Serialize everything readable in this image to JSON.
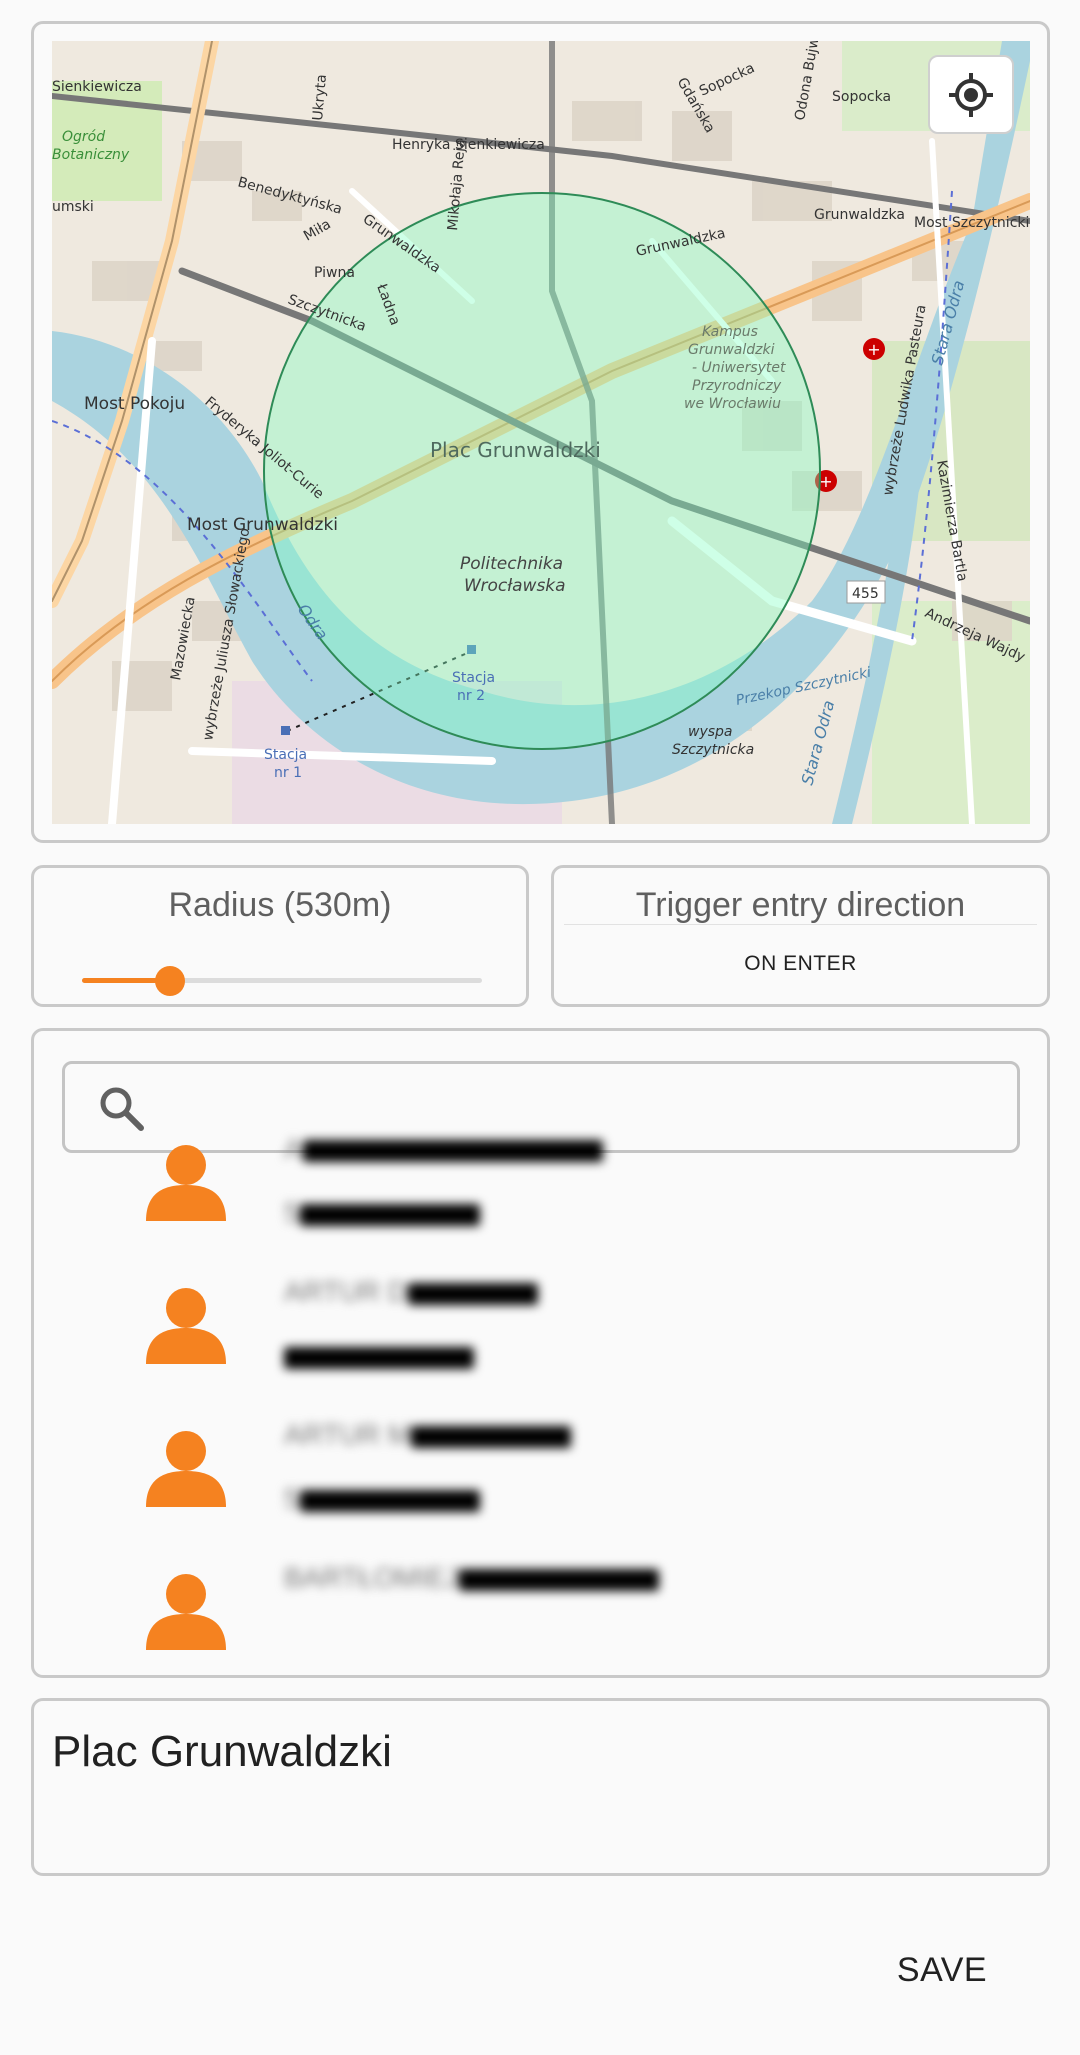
{
  "map": {
    "labels": {
      "street_henryka": "Henryka Sienkiewicza",
      "street_sienkiewicza_left": "Sienkiewicza",
      "ogrod": "Ogród",
      "botaniczny": "Botaniczny",
      "street_umski": "umski",
      "street_benedyktynska": "Benedyktyńska",
      "street_mila": "Miła",
      "street_piwna": "Piwna",
      "street_ladna": "Ładna",
      "street_szczytnicka": "Szczytnicka",
      "street_grunwaldzka1": "Grunwaldzka",
      "street_grunwaldzka2": "Grunwaldzka",
      "street_grunwaldzka3": "Grunwaldzka",
      "street_mikolaja_reja": "Mikołaja Reja",
      "street_ukryta": "Ukryta",
      "street_sopocka1": "Sopocka",
      "street_sopocka2": "Sopocka",
      "street_gdanska": "Gdańska",
      "street_odona": "Odona Bujwida",
      "most_szczytnicki": "Most Szczytnicki",
      "most_pokoju": "Most Pokoju",
      "most_grunwaldzki": "Most Grunwaldzki",
      "plac_grunwaldzki": "Plac Grunwaldzki",
      "politechnika1": "Politechnika",
      "politechnika2": "Wrocławska",
      "kampus1": "Kampus",
      "kampus2": "Grunwaldzki",
      "kampus3": "- Uniwersytet",
      "kampus4": "Przyrodniczy",
      "kampus5": "we Wrocławiu",
      "fryderyka": "Fryderyka Joliot-Curie",
      "odra1": "Odra",
      "stara_odra1": "Stara Odra",
      "stara_odra2": "Stara Odra",
      "pasteura": "wybrzeże Ludwika Pasteura",
      "kazimierza": "Kazimierza Bartla",
      "road_455": "455",
      "andrzeja": "Andrzeja Wajdy",
      "mazowiecka": "Mazowiecka",
      "slowackiego": "wybrzeże Juliusza Słowackiego",
      "stacja1a": "Stacja",
      "stacja1b": "nr 1",
      "stacja2a": "Stacja",
      "stacja2b": "nr 2",
      "przekop": "Przekop Szczytnicki",
      "wyspa1": "wyspa",
      "wyspa2": "Szczytnicka"
    },
    "circle_color": "#7fffc0",
    "circle_stroke": "#2e8b57",
    "locate_icon": "crosshair-gps-icon"
  },
  "radius": {
    "title": "Radius (530m)",
    "value_fraction": 0.22,
    "accent_color": "#f58220"
  },
  "trigger": {
    "title": "Trigger entry direction",
    "value": "ON ENTER"
  },
  "contacts": {
    "search_placeholder": "",
    "search_icon": "search-icon",
    "items": [
      {
        "name": "A",
        "phone": "5",
        "avatar_color": "#f58220"
      },
      {
        "name": "ARTUR D",
        "phone": "",
        "avatar_color": "#f58220"
      },
      {
        "name": "ARTUR M",
        "phone": "5",
        "avatar_color": "#f58220"
      },
      {
        "name": "BARTŁOMIEJ",
        "phone": "",
        "avatar_color": "#f58220"
      }
    ]
  },
  "geofence_name": "Plac Grunwaldzki",
  "save_label": "SAVE"
}
